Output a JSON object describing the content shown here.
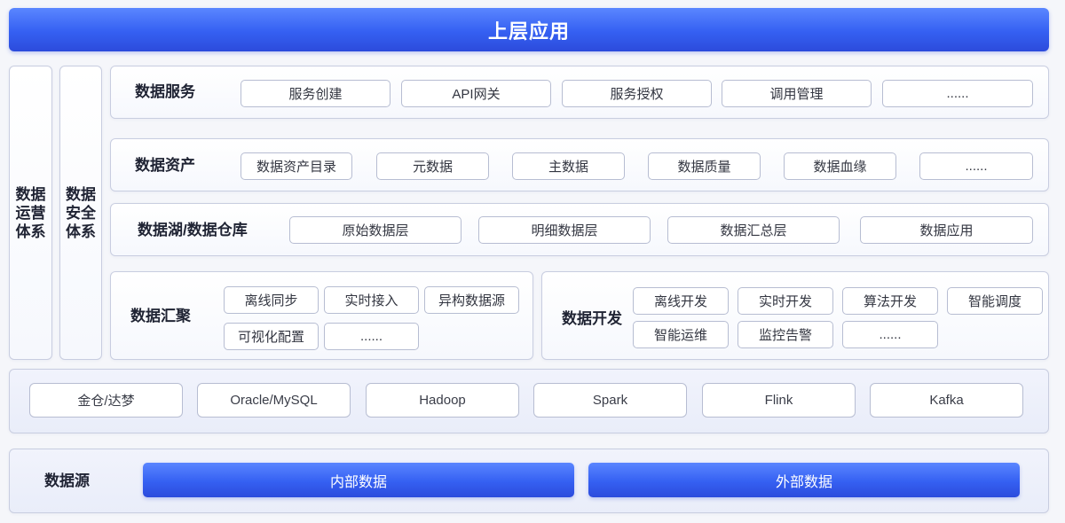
{
  "top_app": {
    "title": "上层应用"
  },
  "side_panels": {
    "operations": "数据运营体系",
    "security": "数据安全体系"
  },
  "data_service": {
    "label": "数据服务",
    "items": [
      "服务创建",
      "API网关",
      "服务授权",
      "调用管理",
      "......"
    ]
  },
  "data_assets": {
    "label": "数据资产",
    "items": [
      "数据资产目录",
      "元数据",
      "主数据",
      "数据质量",
      "数据血缘",
      "......"
    ]
  },
  "data_lake": {
    "label": "数据湖/数据仓库",
    "items": [
      "原始数据层",
      "明细数据层",
      "数据汇总层",
      "数据应用"
    ]
  },
  "data_aggregation": {
    "label": "数据汇聚",
    "items": [
      "离线同步",
      "实时接入",
      "异构数据源",
      "可视化配置",
      "......"
    ]
  },
  "data_development": {
    "label": "数据开发",
    "items": [
      "离线开发",
      "实时开发",
      "算法开发",
      "智能调度",
      "智能运维",
      "监控告警",
      "......"
    ]
  },
  "tech_stack": {
    "items": [
      "金仓/达梦",
      "Oracle/MySQL",
      "Hadoop",
      "Spark",
      "Flink",
      "Kafka"
    ]
  },
  "data_source": {
    "label": "数据源",
    "items": [
      "内部数据",
      "外部数据"
    ]
  },
  "colors": {
    "primary_blue": "#3560f2",
    "panel_border": "#c8cde0",
    "item_border": "#b7bdd2",
    "background": "#f5f6fa"
  }
}
